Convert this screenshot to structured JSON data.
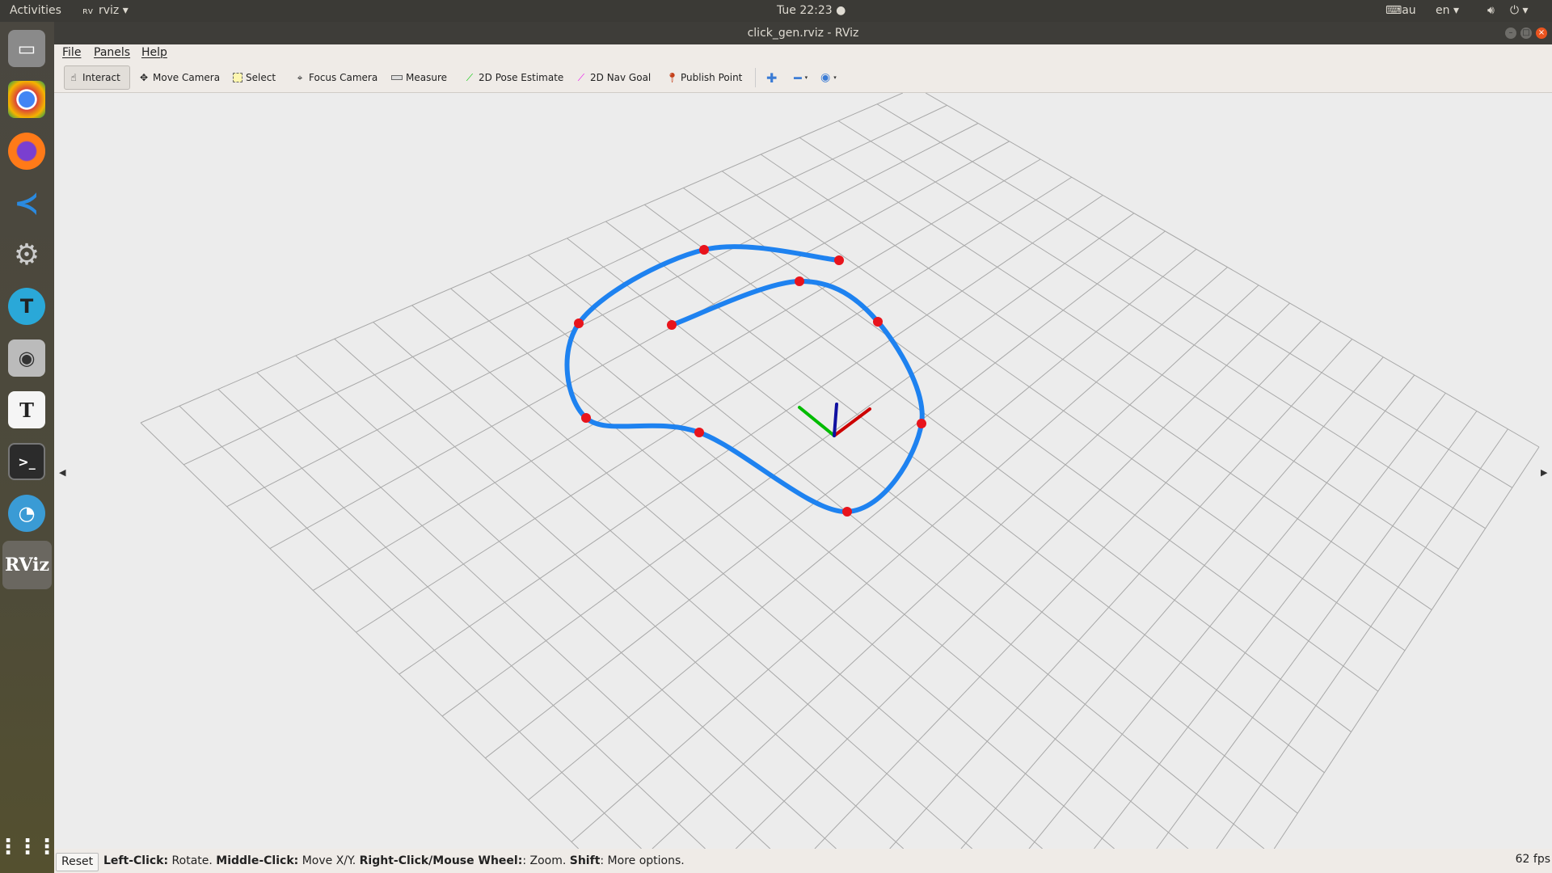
{
  "topbar": {
    "activities": "Activities",
    "app_name": "rviz",
    "clock": "Tue 22:23",
    "keyboard": "au",
    "language": "en"
  },
  "window": {
    "title": "click_gen.rviz - RViz"
  },
  "menu": {
    "file": "File",
    "panels": "Panels",
    "help": "Help"
  },
  "toolbar": {
    "interact": "Interact",
    "move_camera": "Move Camera",
    "select": "Select",
    "focus_camera": "Focus Camera",
    "measure": "Measure",
    "pose_estimate": "2D Pose Estimate",
    "nav_goal": "2D Nav Goal",
    "publish_point": "Publish Point"
  },
  "status": {
    "reset": "Reset",
    "left_click": "Left-Click:",
    "left_action": " Rotate. ",
    "middle_click": "Middle-Click:",
    "middle_action": " Move X/Y. ",
    "right_click": "Right-Click/Mouse Wheel:",
    "right_action": ": Zoom. ",
    "shift": "Shift",
    "shift_action": ": More options.",
    "fps": "62 fps"
  },
  "colors": {
    "path": "#1e82f0",
    "waypoint": "#e8141c",
    "x_axis": "#cc0000",
    "y_axis": "#00bb00",
    "z_axis": "#1010a0"
  }
}
